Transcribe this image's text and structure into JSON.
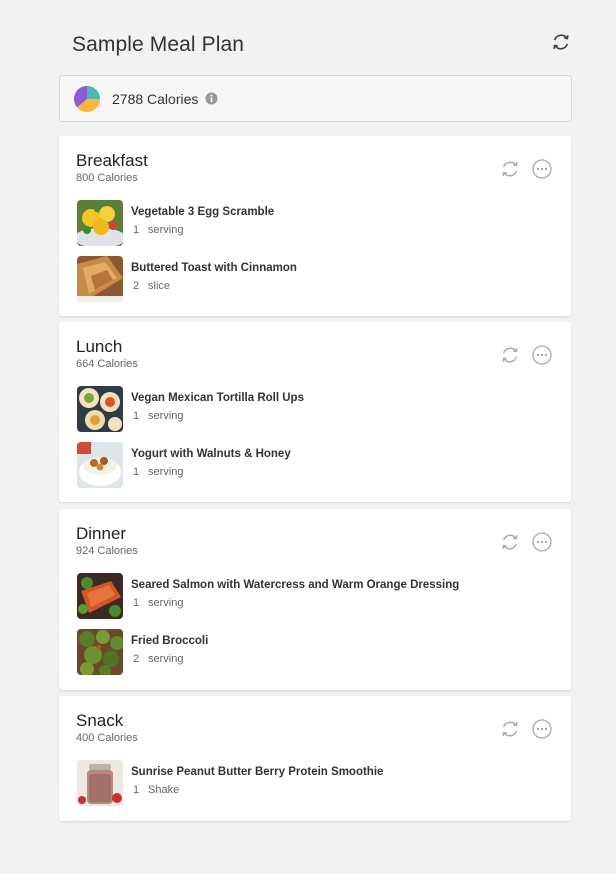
{
  "title": "Sample Meal Plan",
  "summary": {
    "calories": "2788 Calories"
  },
  "colors": {
    "pie_purple": "#8e5bd6",
    "pie_teal": "#4bb8b3",
    "pie_yellow": "#f6b73c",
    "icon_gray": "#aaaaaa"
  },
  "meals": [
    {
      "name": "Breakfast",
      "calories": "800 Calories",
      "items": [
        {
          "name": "Vegetable 3 Egg Scramble",
          "qty": "1",
          "unit": "serving"
        },
        {
          "name": "Buttered Toast with Cinnamon",
          "qty": "2",
          "unit": "slice"
        }
      ]
    },
    {
      "name": "Lunch",
      "calories": "664 Calories",
      "items": [
        {
          "name": "Vegan Mexican Tortilla Roll Ups",
          "qty": "1",
          "unit": "serving"
        },
        {
          "name": "Yogurt with Walnuts & Honey",
          "qty": "1",
          "unit": "serving"
        }
      ]
    },
    {
      "name": "Dinner",
      "calories": "924 Calories",
      "items": [
        {
          "name": "Seared Salmon with Watercress and Warm Orange Dressing",
          "qty": "1",
          "unit": "serving"
        },
        {
          "name": "Fried Broccoli",
          "qty": "2",
          "unit": "serving"
        }
      ]
    },
    {
      "name": "Snack",
      "calories": "400 Calories",
      "items": [
        {
          "name": "Sunrise Peanut Butter Berry Protein Smoothie",
          "qty": "1",
          "unit": "Shake"
        }
      ]
    }
  ]
}
